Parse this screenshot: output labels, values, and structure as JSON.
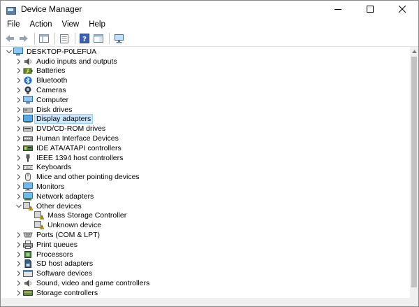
{
  "window": {
    "title": "Device Manager"
  },
  "menu": [
    "File",
    "Action",
    "View",
    "Help"
  ],
  "tree": {
    "root": "DESKTOP-P0LEFUA",
    "categories": [
      {
        "label": "Audio inputs and outputs",
        "icon": "speaker-icon"
      },
      {
        "label": "Batteries",
        "icon": "battery-icon"
      },
      {
        "label": "Bluetooth",
        "icon": "bluetooth-icon"
      },
      {
        "label": "Cameras",
        "icon": "camera-icon"
      },
      {
        "label": "Computer",
        "icon": "computer-icon"
      },
      {
        "label": "Disk drives",
        "icon": "disk-drive-icon"
      },
      {
        "label": "Display adapters",
        "icon": "display-adapter-icon",
        "selected": true
      },
      {
        "label": "DVD/CD-ROM drives",
        "icon": "dvd-drive-icon"
      },
      {
        "label": "Human Interface Devices",
        "icon": "hid-icon"
      },
      {
        "label": "IDE ATA/ATAPI controllers",
        "icon": "ide-controller-icon"
      },
      {
        "label": "IEEE 1394 host controllers",
        "icon": "ieee1394-icon"
      },
      {
        "label": "Keyboards",
        "icon": "keyboard-icon"
      },
      {
        "label": "Mice and other pointing devices",
        "icon": "mouse-icon"
      },
      {
        "label": "Monitors",
        "icon": "monitor-icon"
      },
      {
        "label": "Network adapters",
        "icon": "network-adapter-icon"
      },
      {
        "label": "Other devices",
        "icon": "warning-device-icon",
        "expanded": true,
        "children": [
          {
            "label": "Mass Storage Controller",
            "icon": "warning-device-icon"
          },
          {
            "label": "Unknown device",
            "icon": "warning-device-icon"
          }
        ]
      },
      {
        "label": "Ports (COM & LPT)",
        "icon": "port-icon"
      },
      {
        "label": "Print queues",
        "icon": "printer-icon"
      },
      {
        "label": "Processors",
        "icon": "processor-icon"
      },
      {
        "label": "SD host adapters",
        "icon": "sd-card-icon"
      },
      {
        "label": "Software devices",
        "icon": "software-device-icon"
      },
      {
        "label": "Sound, video and game controllers",
        "icon": "sound-icon"
      },
      {
        "label": "Storage controllers",
        "icon": "storage-controller-icon"
      }
    ]
  },
  "colors": {
    "selection_bg": "#cce8ff",
    "selection_border": "#99d1ff"
  }
}
